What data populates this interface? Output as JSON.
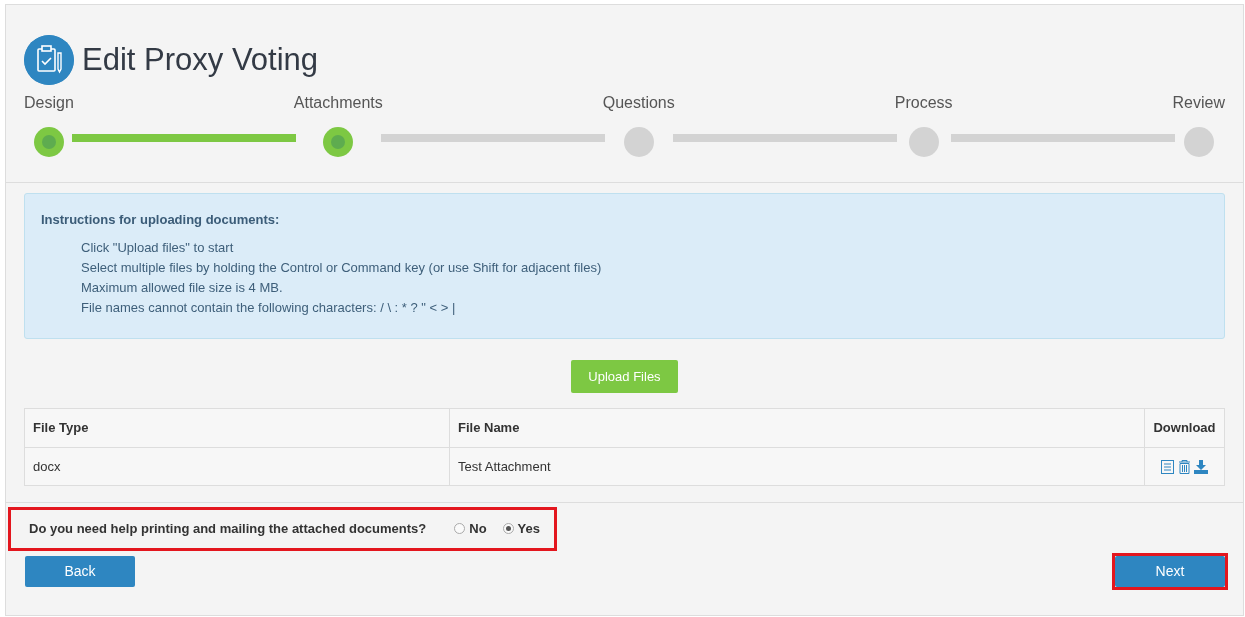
{
  "title": "Edit Proxy Voting",
  "steps": [
    {
      "label": "Design",
      "completed": true
    },
    {
      "label": "Attachments",
      "completed": true
    },
    {
      "label": "Questions",
      "completed": false
    },
    {
      "label": "Process",
      "completed": false
    },
    {
      "label": "Review",
      "completed": false
    }
  ],
  "instructions": {
    "heading": "Instructions for uploading documents:",
    "lines": [
      "Click \"Upload files\" to start",
      "Select multiple files by holding the Control or Command key (or use Shift for adjacent files)",
      "Maximum allowed file size is 4 MB.",
      "File names cannot contain the following characters: / \\ : * ? \" < > |"
    ]
  },
  "upload_button": "Upload Files",
  "table": {
    "columns": [
      "File Type",
      "File Name",
      "Download"
    ],
    "rows": [
      {
        "cells": [
          "docx",
          "Test Attachment"
        ]
      }
    ]
  },
  "question": {
    "text": "Do you need help printing and mailing the attached documents?",
    "highlighted": true,
    "options": [
      {
        "label": "No",
        "selected": false
      },
      {
        "label": "Yes",
        "selected": true
      }
    ]
  },
  "back_button": {
    "label": "Back",
    "highlighted": false
  },
  "next_button": {
    "label": "Next",
    "highlighted": true
  }
}
